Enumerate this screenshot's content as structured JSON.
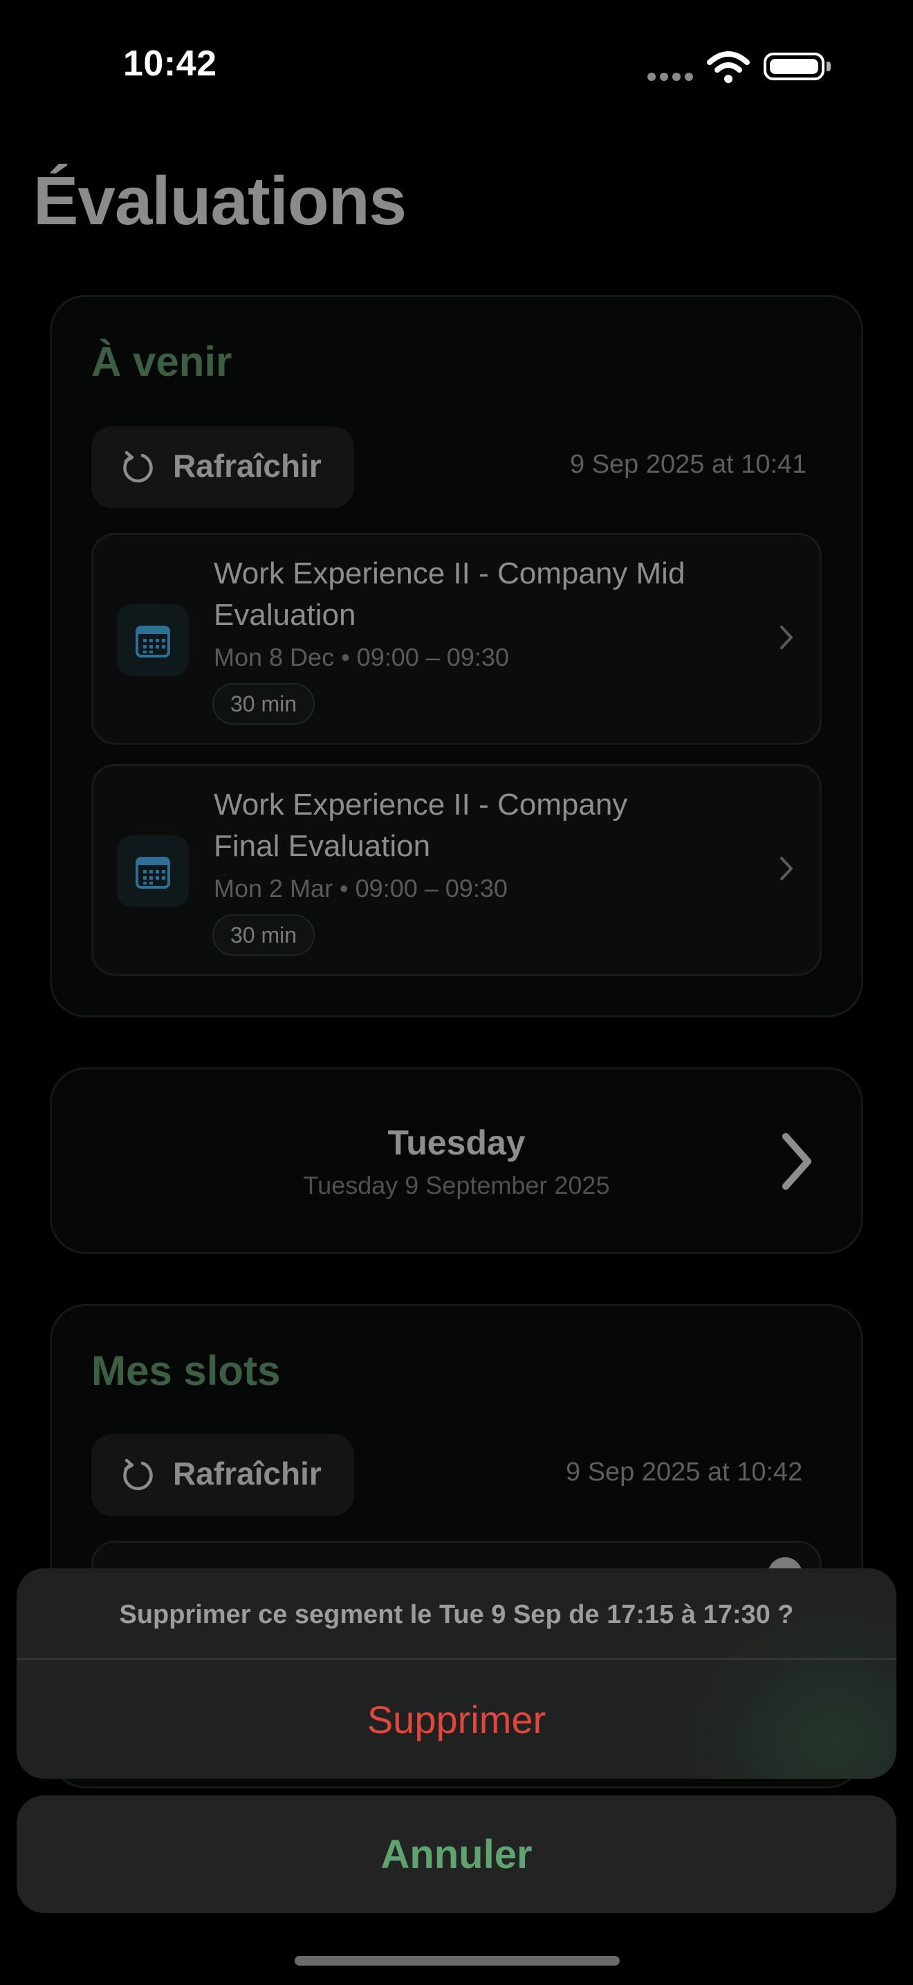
{
  "status_bar": {
    "time": "10:42"
  },
  "page_title": "Évaluations",
  "upcoming": {
    "title": "À venir",
    "refresh_label": "Rafraîchir",
    "timestamp": "9 Sep 2025 at 10:41",
    "items": [
      {
        "title": "Work Experience II - Company Mid Evaluation",
        "meta": "Mon 8 Dec • 09:00 – 09:30",
        "duration": "30 min"
      },
      {
        "title": "Work Experience II - Company Final Evaluation",
        "meta": "Mon 2 Mar • 09:00 – 09:30",
        "duration": "30 min"
      }
    ]
  },
  "date_selector": {
    "day": "Tuesday",
    "full_date": "Tuesday 9 September 2025"
  },
  "my_slots": {
    "title": "Mes slots",
    "refresh_label": "Rafraîchir",
    "timestamp": "9 Sep 2025 at 10:42"
  },
  "action_sheet": {
    "message": "Supprimer ce segment le Tue 9 Sep de 17:15 à 17:30 ?",
    "destructive_label": "Supprimer",
    "cancel_label": "Annuler"
  },
  "colors": {
    "accent_green": "#5fa36f",
    "section_title_green": "#3c5f43",
    "destructive_red": "#e3463c",
    "calendar_icon_blue": "#2f6f93"
  },
  "icons": [
    "wifi-icon",
    "battery-icon",
    "refresh-icon",
    "calendar-icon",
    "chevron-right-icon"
  ]
}
